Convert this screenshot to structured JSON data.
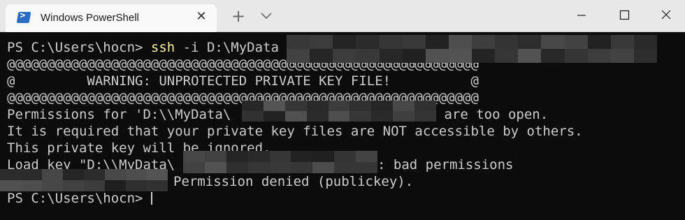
{
  "window": {
    "tab_title": "Windows PowerShell",
    "tab_icon": "powershell-icon",
    "colors": {
      "titlebar_bg": "#e8e8e8",
      "tab_bg": "#f9f9f9",
      "terminal_bg": "#0c0c0c",
      "terminal_fg": "#cccccc",
      "command_fg": "#f9f1a5"
    }
  },
  "terminal": {
    "line1": {
      "prompt": "PS C:\\Users\\hocn> ",
      "command": "ssh",
      "args": " -i D:\\MyData"
    },
    "line2": "@@@@@@@@@@@@@@@@@@@@@@@@@@@@@@@@@@@@@@@@@@@@@@@@@@@@@@@@@@@",
    "line3": "@         WARNING: UNPROTECTED PRIVATE KEY FILE!          @",
    "line4": "@@@@@@@@@@@@@@@@@@@@@@@@@@@@@@@@@@@@@@@@@@@@@@@@@@@@@@@@@@@",
    "line5_a": "Permissions for 'D:\\\\MyData\\",
    "line5_b": " are too open.",
    "line6": "It is required that your private key files are NOT accessible by others.",
    "line7": "This private key will be ignored.",
    "line8_a": "Load key \"D:\\\\MyData\\",
    "line8_b": ": bad permissions",
    "line9": "Permission denied (publickey).",
    "line10": "PS C:\\Users\\hocn>"
  }
}
